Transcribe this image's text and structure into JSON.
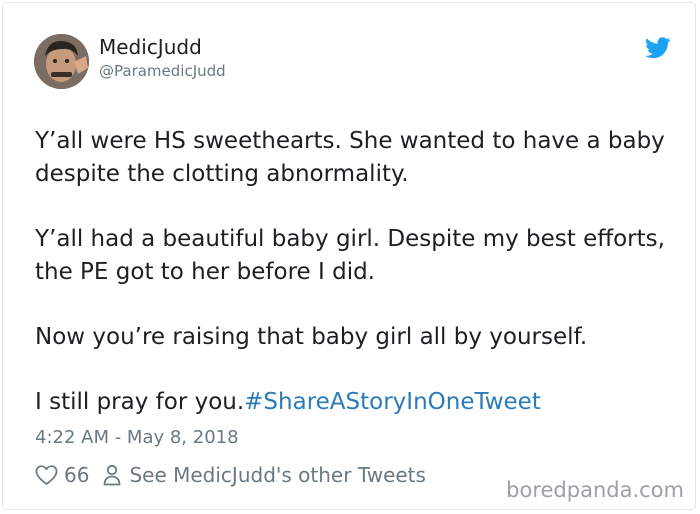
{
  "user": {
    "display_name": "MedicJudd",
    "handle": "@ParamedicJudd"
  },
  "tweet": {
    "paragraphs": [
      "Y’all were HS sweethearts. She wanted to have a baby despite the clotting abnormality.",
      "Y’all had a beautiful baby girl. Despite my best efforts, the PE got to her before I did.",
      "Now you’re raising that baby girl all by yourself."
    ],
    "last_line": "I still pray for you.",
    "hashtag": "#ShareAStoryInOneTweet",
    "timestamp": "4:22 AM - May 8, 2018"
  },
  "actions": {
    "like_count": "66",
    "other_tweets_label": "See MedicJudd's other Tweets"
  },
  "watermark": "boredpanda.com",
  "colors": {
    "twitter_blue": "#1da1f2",
    "link": "#2b7bb9",
    "secondary_text": "#697882"
  },
  "icons": [
    "twitter-bird-icon",
    "heart-icon",
    "person-icon"
  ]
}
